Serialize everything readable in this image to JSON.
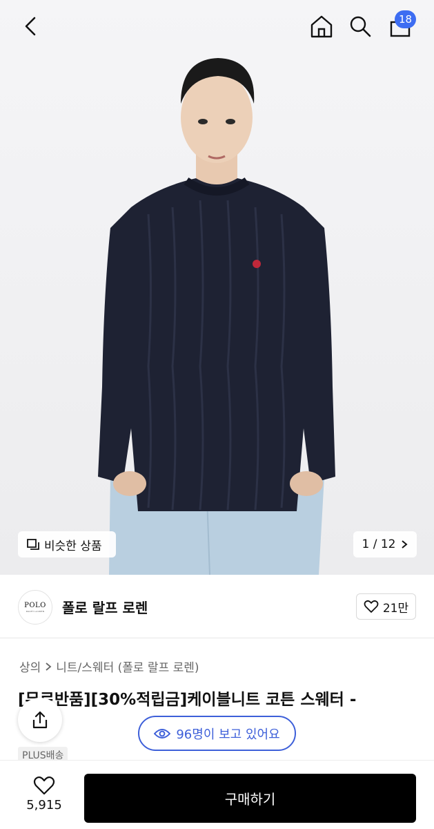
{
  "header": {
    "cart_badge": "18",
    "icons": [
      "back-arrow-icon",
      "home-icon",
      "search-icon",
      "shopping-bag-icon"
    ]
  },
  "gallery": {
    "similar_label": "비슷한 상품",
    "pager_text": "1 / 12"
  },
  "brand": {
    "logo_text": "POLO",
    "logo_sub": "RALPH LAUREN",
    "name": "폴로 랄프 로렌",
    "like_count": "21만"
  },
  "breadcrumb": {
    "category": "상의",
    "subcategory": "니트/스웨터 (폴로 랄프 로렌)"
  },
  "product": {
    "title": "[무료반품][30%적립금]케이블니트 코튼 스웨터 -",
    "viewers": "96명이 보고 있어요",
    "shipping_tag": "PLUS배송"
  },
  "bottom": {
    "wish_count": "5,915",
    "buy_label": "구매하기"
  },
  "colors": {
    "accent": "#3d5fd9",
    "badge": "#3d6df2",
    "sweater": "#1e2233",
    "buy": "#000000"
  }
}
